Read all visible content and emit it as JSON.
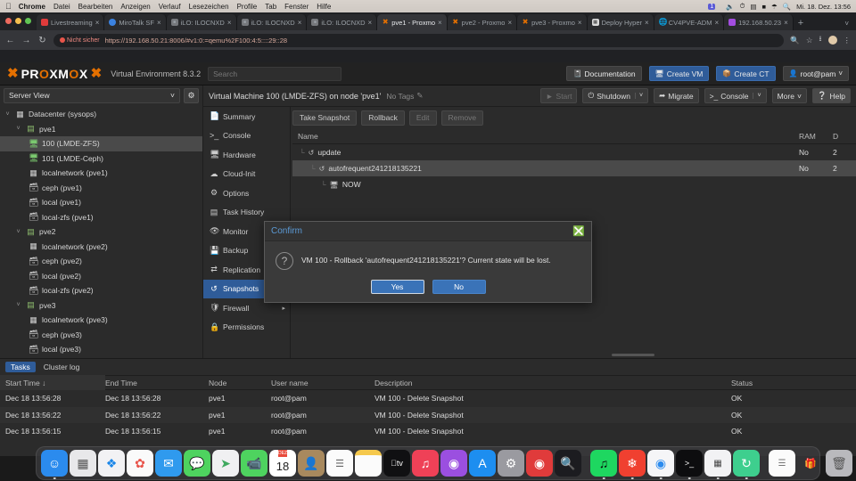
{
  "menubar": {
    "apple": "apple-logo",
    "items": [
      "Chrome",
      "Datei",
      "Bearbeiten",
      "Anzeigen",
      "Verlauf",
      "Lesezeichen",
      "Profile",
      "Tab",
      "Fenster",
      "Hilfe"
    ],
    "status_badge": "1",
    "clock": "Mi. 18. Dez. 13:56"
  },
  "browser": {
    "tabs": [
      {
        "label": "Livestreaming",
        "favicon": "red-square",
        "active": false
      },
      {
        "label": "MiroTalk SF",
        "favicon": "blue-circle",
        "active": false
      },
      {
        "label": "iLO: ILOCNXD",
        "favicon": "hpe-logo",
        "active": false
      },
      {
        "label": "iLO: ILOCNXD",
        "favicon": "hpe-logo",
        "active": false
      },
      {
        "label": "iLO: ILOCNXD",
        "favicon": "hpe-logo",
        "active": false
      },
      {
        "label": "pve1 - Proxmo",
        "favicon": "proxmox-logo",
        "active": true
      },
      {
        "label": "pve2 - Proxmo",
        "favicon": "proxmox-logo",
        "active": false
      },
      {
        "label": "pve3 - Proxmo",
        "favicon": "proxmox-logo",
        "active": false
      },
      {
        "label": "Deploy Hyper",
        "favicon": "deploy-logo",
        "active": false
      },
      {
        "label": "CV4PVE-ADM",
        "favicon": "globe-logo",
        "active": false
      },
      {
        "label": "192.168.50.23",
        "favicon": "purple-square",
        "active": false
      }
    ],
    "new_tab": "+",
    "tab_list_chevron": "˅",
    "back": "←",
    "forward": "→",
    "reload": "↻",
    "security_label": "Nicht sicher",
    "url": "https://192.168.50.21:8006/#v1:0:=qemu%2F100:4:5::::29::28",
    "toolbar_icons": [
      "zoom-icon",
      "bookmark-star-icon",
      "download-icon",
      "profile-avatar",
      "chrome-menu-icon"
    ]
  },
  "pve": {
    "brand": "PROXMOX",
    "version": "Virtual Environment 8.3.2",
    "search_placeholder": "Search",
    "header_buttons": [
      {
        "label": "Documentation",
        "icon": "book-icon",
        "style": "grey"
      },
      {
        "label": "Create VM",
        "icon": "monitor-icon",
        "style": "blue"
      },
      {
        "label": "Create CT",
        "icon": "box-icon",
        "style": "blue"
      },
      {
        "label": "root@pam",
        "icon": "user-icon",
        "style": "grey",
        "chevron": "˅"
      }
    ],
    "sidebar": {
      "view_label": "Server View",
      "view_chevron": "˅",
      "gear": "gear-icon",
      "tree": [
        {
          "label": "Datacenter (sysops)",
          "icon": "datacenter-icon",
          "depth": 0,
          "twisty": "˅",
          "selected": false
        },
        {
          "label": "pve1",
          "icon": "node-icon",
          "depth": 1,
          "twisty": "˅",
          "selected": false
        },
        {
          "label": "100 (LMDE-ZFS)",
          "icon": "vm-icon",
          "depth": 2,
          "twisty": "",
          "selected": true
        },
        {
          "label": "101 (LMDE-Ceph)",
          "icon": "vm-icon",
          "depth": 2,
          "twisty": "",
          "selected": false
        },
        {
          "label": "localnetwork (pve1)",
          "icon": "network-icon",
          "depth": 2,
          "twisty": "",
          "selected": false
        },
        {
          "label": "ceph (pve1)",
          "icon": "storage-icon",
          "depth": 2,
          "twisty": "",
          "selected": false
        },
        {
          "label": "local (pve1)",
          "icon": "storage-icon",
          "depth": 2,
          "twisty": "",
          "selected": false
        },
        {
          "label": "local-zfs (pve1)",
          "icon": "storage-icon",
          "depth": 2,
          "twisty": "",
          "selected": false
        },
        {
          "label": "pve2",
          "icon": "node-icon",
          "depth": 1,
          "twisty": "˅",
          "selected": false
        },
        {
          "label": "localnetwork (pve2)",
          "icon": "network-icon",
          "depth": 2,
          "twisty": "",
          "selected": false
        },
        {
          "label": "ceph (pve2)",
          "icon": "storage-icon",
          "depth": 2,
          "twisty": "",
          "selected": false
        },
        {
          "label": "local (pve2)",
          "icon": "storage-icon",
          "depth": 2,
          "twisty": "",
          "selected": false
        },
        {
          "label": "local-zfs (pve2)",
          "icon": "storage-icon",
          "depth": 2,
          "twisty": "",
          "selected": false
        },
        {
          "label": "pve3",
          "icon": "node-icon",
          "depth": 1,
          "twisty": "˅",
          "selected": false
        },
        {
          "label": "localnetwork (pve3)",
          "icon": "network-icon",
          "depth": 2,
          "twisty": "",
          "selected": false
        },
        {
          "label": "ceph (pve3)",
          "icon": "storage-icon",
          "depth": 2,
          "twisty": "",
          "selected": false
        },
        {
          "label": "local (pve3)",
          "icon": "storage-icon",
          "depth": 2,
          "twisty": "",
          "selected": false
        }
      ]
    },
    "vm_menu": [
      {
        "label": "Summary",
        "icon": "summary-icon",
        "selected": false
      },
      {
        "label": "Console",
        "icon": "console-icon",
        "selected": false
      },
      {
        "label": "Hardware",
        "icon": "hardware-icon",
        "selected": false
      },
      {
        "label": "Cloud-Init",
        "icon": "cloud-icon",
        "selected": false
      },
      {
        "label": "Options",
        "icon": "gear-icon",
        "selected": false
      },
      {
        "label": "Task History",
        "icon": "history-icon",
        "selected": false
      },
      {
        "label": "Monitor",
        "icon": "eye-icon",
        "selected": false
      },
      {
        "label": "Backup",
        "icon": "save-icon",
        "selected": false
      },
      {
        "label": "Replication",
        "icon": "replication-icon",
        "selected": false
      },
      {
        "label": "Snapshots",
        "icon": "snapshot-icon",
        "selected": true
      },
      {
        "label": "Firewall",
        "icon": "shield-icon",
        "selected": false,
        "submenu_arrow": "▸"
      },
      {
        "label": "Permissions",
        "icon": "lock-icon",
        "selected": false
      }
    ],
    "content_header": {
      "title": "Virtual Machine 100 (LMDE-ZFS) on node 'pve1'",
      "tags_label": "No Tags",
      "tags_edit_icon": "pencil-icon",
      "buttons": [
        {
          "label": "Start",
          "icon": "play-icon",
          "disabled": true
        },
        {
          "label": "Shutdown",
          "icon": "power-icon",
          "disabled": false,
          "chevron": "˅"
        },
        {
          "label": "Migrate",
          "icon": "migrate-icon",
          "disabled": false
        },
        {
          "label": "Console",
          "icon": "console-icon",
          "disabled": false,
          "chevron": "˅"
        },
        {
          "label": "More",
          "icon": "",
          "disabled": false,
          "chevron": "˅"
        },
        {
          "label": "Help",
          "icon": "help-icon",
          "disabled": false
        }
      ]
    },
    "snapshots": {
      "toolbar": [
        {
          "label": "Take Snapshot",
          "dim": false
        },
        {
          "label": "Rollback",
          "dim": false
        },
        {
          "label": "Edit",
          "dim": true
        },
        {
          "label": "Remove",
          "dim": true
        }
      ],
      "columns": [
        "Name",
        "RAM",
        "D"
      ],
      "rows": [
        {
          "name": "update",
          "icon": "snapshot-icon",
          "ram": "No",
          "date": "2",
          "depth": 0,
          "selected": false
        },
        {
          "name": "autofrequent241218135221",
          "icon": "snapshot-icon",
          "ram": "No",
          "date": "2",
          "depth": 1,
          "selected": true
        },
        {
          "name": "NOW",
          "icon": "monitor-icon",
          "ram": "",
          "date": "",
          "depth": 2,
          "selected": false
        }
      ]
    },
    "dialog": {
      "title": "Confirm",
      "close_icon": "close-icon",
      "question_icon": "question-icon",
      "message": "VM 100 - Rollback 'autofrequent241218135221'? Current state will be lost.",
      "yes_label": "Yes",
      "no_label": "No"
    },
    "tasks": {
      "tabs": [
        {
          "label": "Tasks",
          "selected": true
        },
        {
          "label": "Cluster log",
          "selected": false
        }
      ],
      "columns": [
        "Start Time ↓",
        "End Time",
        "Node",
        "User name",
        "Description",
        "Status"
      ],
      "rows": [
        {
          "start": "Dec 18 13:56:28",
          "end": "Dec 18 13:56:28",
          "node": "pve1",
          "user": "root@pam",
          "description": "VM 100 - Delete Snapshot",
          "status": "OK"
        },
        {
          "start": "Dec 18 13:56:22",
          "end": "Dec 18 13:56:22",
          "node": "pve1",
          "user": "root@pam",
          "description": "VM 100 - Delete Snapshot",
          "status": "OK"
        },
        {
          "start": "Dec 18 13:56:15",
          "end": "Dec 18 13:56:15",
          "node": "pve1",
          "user": "root@pam",
          "description": "VM 100 - Delete Snapshot",
          "status": "OK"
        }
      ]
    }
  },
  "dock": {
    "calendar_month": "DEZ",
    "calendar_day": "18",
    "items": [
      {
        "name": "finder-icon",
        "glyph": "☺",
        "bg": "#2b8bee",
        "running": true
      },
      {
        "name": "launchpad-icon",
        "glyph": "☷",
        "bg": "#e8e8ea",
        "running": false
      },
      {
        "name": "safari-icon",
        "glyph": "✧",
        "bg": "#f2f2f4",
        "running": false
      },
      {
        "name": "photos-icon",
        "glyph": "✿",
        "bg": "#fafafa",
        "running": false
      },
      {
        "name": "mail-icon",
        "glyph": "✉",
        "bg": "#2f9aee",
        "running": false
      },
      {
        "name": "messages-icon",
        "glyph": "◯",
        "bg": "#4ed35f",
        "running": false
      },
      {
        "name": "maps-icon",
        "glyph": "➤",
        "bg": "#f0f0f2",
        "running": false
      },
      {
        "name": "facetime-icon",
        "glyph": "▶",
        "bg": "#4ed35f",
        "running": false
      },
      {
        "name": "calendar-icon",
        "glyph": "",
        "bg": "#ffffff",
        "running": false
      },
      {
        "name": "contacts-icon",
        "glyph": "●",
        "bg": "#a8895e",
        "running": false
      },
      {
        "name": "reminders-icon",
        "glyph": "☰",
        "bg": "#fbfbfb",
        "running": false
      },
      {
        "name": "notes-icon",
        "glyph": "",
        "bg": "#fbfbfb",
        "running": false
      },
      {
        "name": "tv-icon",
        "glyph": "tv",
        "bg": "#101012",
        "running": false
      },
      {
        "name": "music-icon",
        "glyph": "♫",
        "bg": "#ef4157",
        "running": false
      },
      {
        "name": "podcasts-icon",
        "glyph": "◉",
        "bg": "#9b4fe0",
        "running": false
      },
      {
        "name": "app-store-icon",
        "glyph": "A",
        "bg": "#1d8ef0",
        "running": false
      },
      {
        "name": "system-settings-icon",
        "glyph": "⚙",
        "bg": "#9a9aa0",
        "running": false
      },
      {
        "name": "keychain-icon",
        "glyph": "◉",
        "bg": "#e03b3b",
        "running": false
      },
      {
        "name": "spotlight-icon",
        "glyph": "◔",
        "bg": "#1c1c20",
        "running": false
      },
      {
        "name": "spotify-icon",
        "glyph": "♪",
        "bg": "#1ed760",
        "running": true
      },
      {
        "name": "vlc-icon",
        "glyph": "✸",
        "bg": "#f04030",
        "running": true
      },
      {
        "name": "chrome-icon",
        "glyph": "●",
        "bg": "#f5f5f7",
        "running": true
      },
      {
        "name": "terminal-icon",
        "glyph": "⌫",
        "bg": "#0d0d0f",
        "running": true
      },
      {
        "name": "calculator-icon",
        "glyph": "∷",
        "bg": "#f2f2f4",
        "running": true
      },
      {
        "name": "sync-icon",
        "glyph": "↻",
        "bg": "#3ecf8e",
        "running": true
      }
    ],
    "right_items": [
      {
        "name": "document-icon",
        "glyph": "☰",
        "bg": "#fbfbfb"
      },
      {
        "name": "trash-icon",
        "glyph": "ᴵ",
        "bg": "#b9b9bd"
      }
    ]
  }
}
